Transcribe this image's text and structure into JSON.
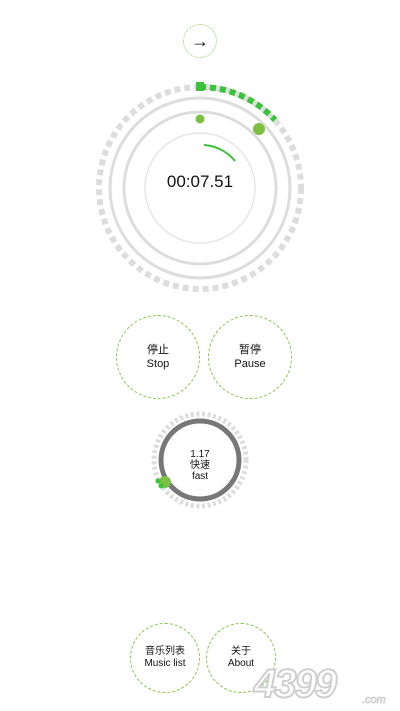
{
  "header": {
    "arrow_label": "→"
  },
  "timer": {
    "elapsed": "00:07.51"
  },
  "controls": {
    "stop": {
      "zh": "停止",
      "en": "Stop"
    },
    "pause": {
      "zh": "暂停",
      "en": "Pause"
    }
  },
  "speed": {
    "value": "1.17",
    "zh": "快速",
    "en": "fast"
  },
  "bottom_nav": {
    "music_list": {
      "zh": "音乐列表",
      "en": "Music list"
    },
    "about": {
      "zh": "关于",
      "en": "About"
    }
  },
  "watermark": {
    "text": "4399.com"
  },
  "colors": {
    "accent": "#3ac33a",
    "light_green": "#8bc34a",
    "ring_gray": "#dddddd",
    "dark_ring": "#777777"
  }
}
